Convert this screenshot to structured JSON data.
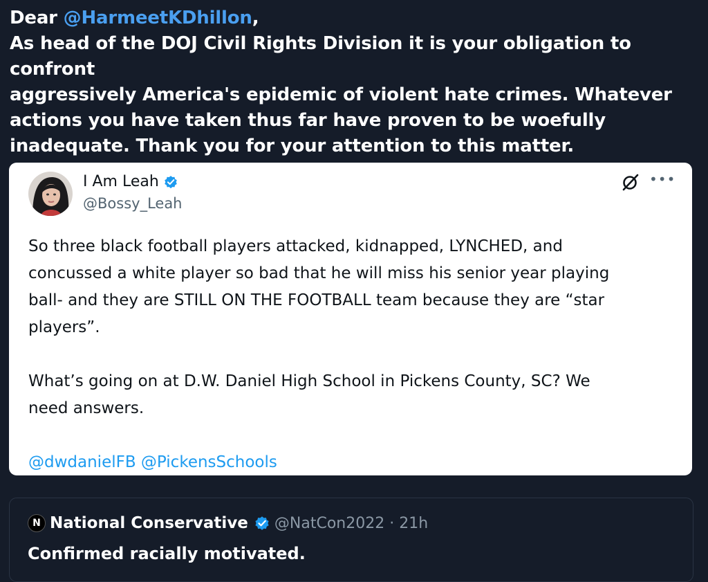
{
  "post": {
    "greeting": "Dear ",
    "mention": "@HarmeetKDhillon",
    "greeting_suffix": ",",
    "lines": [
      "As head of the DOJ Civil Rights Division it is your obligation to confront",
      "aggressively America's epidemic of violent hate crimes. Whatever",
      "actions you have taken thus far have proven to be woefully",
      "inadequate. Thank you for your attention to this matter."
    ]
  },
  "quote": {
    "author_name": "I Am Leah",
    "author_handle": "@Bossy_Leah",
    "paragraph1": [
      "So three black football players attacked, kidnapped, LYNCHED, and",
      "concussed a white player so bad that he will miss his senior year playing",
      "ball- and they are STILL ON THE FOOTBALL team because they are “star",
      "players”."
    ],
    "paragraph2": [
      "What’s going on at D.W. Daniel High School in Pickens County, SC? We",
      "need answers."
    ],
    "mentions": "@dwdanielFB @PickensSchools",
    "more_label": "•••",
    "grok_icon": "grok-icon",
    "verified_color": "#1d9bf0"
  },
  "next": {
    "avatar_letter": "N",
    "author_name": "National Conservative",
    "meta": "@NatCon2022 · 21h",
    "text": "Confirmed racially motivated."
  },
  "colors": {
    "background": "#151c29",
    "mention": "#4a9ff0",
    "link": "#1d9bf0"
  }
}
